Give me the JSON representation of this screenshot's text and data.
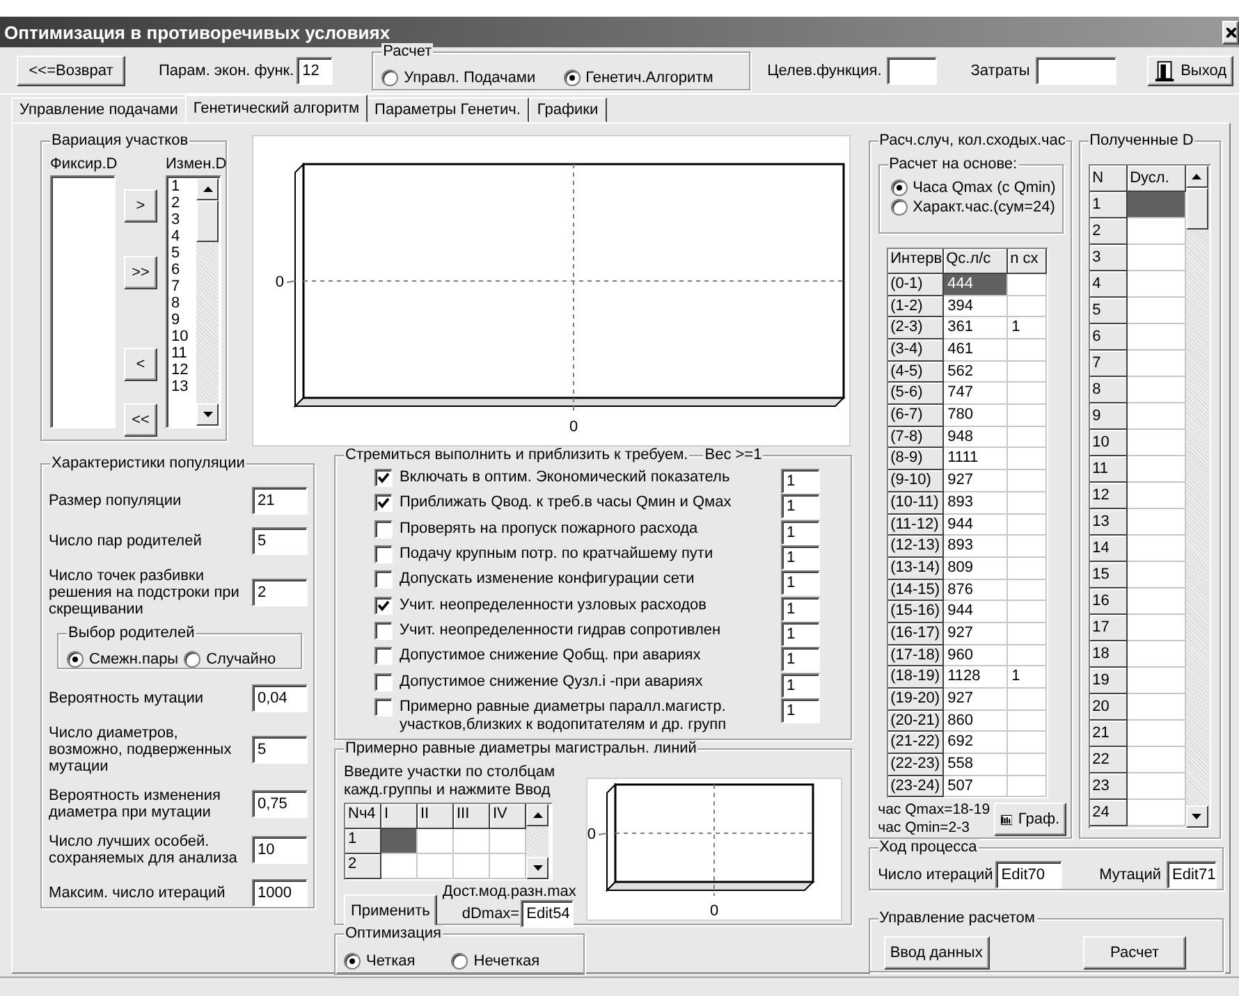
{
  "window": {
    "title": "Оптимизация в противоречивых условиях"
  },
  "toolbar": {
    "back_button": "<<=Возврат",
    "econ_param": {
      "label": "Парам. экон. функ.",
      "value": "12"
    },
    "calc_group": {
      "title": "Расчет",
      "options": [
        {
          "label": "Управл. Подачами",
          "selected": false
        },
        {
          "label": "Генетич.Алгоритм",
          "selected": true
        }
      ]
    },
    "objective": {
      "label": "Целев.функция."
    },
    "costs": {
      "label": "Затраты"
    },
    "exit_button": "Выход"
  },
  "tabs": [
    {
      "label": "Управление подачами",
      "selected": false
    },
    {
      "label": "Генетический алгоритм",
      "selected": true
    },
    {
      "label": "Параметры Генетич.",
      "selected": false
    },
    {
      "label": "Графики",
      "selected": false
    }
  ],
  "variation": {
    "title": "Вариация участков",
    "fixed_label": "Фиксир.D",
    "changed_label": "Измен.D",
    "changed_items": [
      "1",
      "2",
      "3",
      "4",
      "5",
      "6",
      "7",
      "8",
      "9",
      "10",
      "11",
      "12",
      "13"
    ],
    "buttons": [
      ">",
      ">>",
      "<",
      "<<"
    ]
  },
  "chart_top": {
    "y_tick": "0",
    "x_tick": "0"
  },
  "population": {
    "title": "Характеристики популяции",
    "items": [
      {
        "kind": "field",
        "label": "Размер популяции",
        "value": "21"
      },
      {
        "kind": "field",
        "label": "Число пар родителей",
        "value": "5"
      },
      {
        "kind": "field",
        "label": "Число точек разбивки решения на подстроки при скрещивании",
        "value": "2"
      },
      {
        "kind": "radio_group",
        "title": "Выбор родителей",
        "options": [
          {
            "label": "Смежн.пары",
            "selected": true
          },
          {
            "label": "Случайно",
            "selected": false
          }
        ]
      },
      {
        "kind": "field",
        "label": "Вероятность мутации",
        "value": "0,04"
      },
      {
        "kind": "field",
        "label": "Число диаметров, возможно, подверженных мутации",
        "value": "5"
      },
      {
        "kind": "field",
        "label": "Вероятность изменения диаметра при мутации",
        "value": "0,75"
      },
      {
        "kind": "field",
        "label": "Число лучших особей. сохраняемых для анализа",
        "value": "10"
      },
      {
        "kind": "field",
        "label": "Максим. число итераций",
        "value": "1000"
      }
    ]
  },
  "goals": {
    "title": "Стремиться выполнить и приблизить к требуем.",
    "weight_title": "Вес >=1",
    "items": [
      {
        "label": "Включать в оптим. Экономический показатель",
        "checked": true,
        "weight": "1"
      },
      {
        "label": "Приближать Qвод. к треб.в часы Qмин и Qмах",
        "checked": true,
        "weight": "1"
      },
      {
        "label": "Проверять на пропуск пожарного расхода",
        "checked": false,
        "weight": "1"
      },
      {
        "label": "Подачу крупным потр. по кратчайшему пути",
        "checked": false,
        "weight": "1"
      },
      {
        "label": "Допускать изменение конфигурации сети",
        "checked": false,
        "weight": "1"
      },
      {
        "label": "Учит. неопределенности узловых расходов",
        "checked": true,
        "weight": "1"
      },
      {
        "label": "Учит. неопределенности гидрав сопротивлен",
        "checked": false,
        "weight": "1"
      },
      {
        "label": "Допустимое снижение Qобщ. при авариях",
        "checked": false,
        "weight": "1"
      },
      {
        "label": "Допустимое снижение Qузл.i -при авариях",
        "checked": false,
        "weight": "1"
      },
      {
        "label": "Примерно равные диаметры паралл.магистр. участков,близких к водопитателям и др. групп",
        "checked": false,
        "weight": "1"
      }
    ]
  },
  "diameters": {
    "title": "Примерно равные диаметры магистральн. линий",
    "instruction": "Введите участки по столбцам кажд.группы и нажмите Ввод",
    "columns": [
      "Nч4",
      "I",
      "II",
      "III",
      "IV"
    ],
    "rows": [
      {
        "label": "1",
        "selected": true
      },
      {
        "label": "2",
        "selected": false
      }
    ],
    "apply_button": "Применить",
    "dmax_label": "Дост.мод.разн.max",
    "dmax_prefix": "dDmax=",
    "dmax_value": "Edit54",
    "chart": {
      "y_tick": "0",
      "x_tick": "0"
    }
  },
  "optimization": {
    "title": "Оптимизация",
    "options": [
      {
        "label": "Четкая",
        "selected": true
      },
      {
        "label": "Нечеткая",
        "selected": false
      }
    ]
  },
  "calc_hours": {
    "title": "Расч.случ, кол.сходых.час",
    "basis_title": "Расчет на основе:",
    "basis_options": [
      {
        "label": "Часа Qmax (с Qmin)",
        "selected": true
      },
      {
        "label": "Характ.час.(сум=24)",
        "selected": false
      }
    ],
    "columns": [
      "Интерв",
      "Qc.л/с",
      "n cx"
    ],
    "rows": [
      {
        "interval": "(0-1)",
        "q": "444",
        "selected": true
      },
      {
        "interval": "(1-2)",
        "q": "394",
        "selected": false
      },
      {
        "interval": "(2-3)",
        "q": "361",
        "n": "1",
        "selected": false
      },
      {
        "interval": "(3-4)",
        "q": "461",
        "selected": false
      },
      {
        "interval": "(4-5)",
        "q": "562",
        "selected": false
      },
      {
        "interval": "(5-6)",
        "q": "747",
        "selected": false
      },
      {
        "interval": "(6-7)",
        "q": "780",
        "selected": false
      },
      {
        "interval": "(7-8)",
        "q": "948",
        "selected": false
      },
      {
        "interval": "(8-9)",
        "q": "1111",
        "selected": false
      },
      {
        "interval": "(9-10)",
        "q": "927",
        "selected": false
      },
      {
        "interval": "(10-11)",
        "q": "893",
        "selected": false
      },
      {
        "interval": "(11-12)",
        "q": "944",
        "selected": false
      },
      {
        "interval": "(12-13)",
        "q": "893",
        "selected": false
      },
      {
        "interval": "(13-14)",
        "q": "809",
        "selected": false
      },
      {
        "interval": "(14-15)",
        "q": "876",
        "selected": false
      },
      {
        "interval": "(15-16)",
        "q": "944",
        "selected": false
      },
      {
        "interval": "(16-17)",
        "q": "927",
        "selected": false
      },
      {
        "interval": "(17-18)",
        "q": "960",
        "selected": false
      },
      {
        "interval": "(18-19)",
        "q": "1128",
        "n": "1",
        "selected": false
      },
      {
        "interval": "(19-20)",
        "q": "927",
        "selected": false
      },
      {
        "interval": "(20-21)",
        "q": "860",
        "selected": false
      },
      {
        "interval": "(21-22)",
        "q": "692",
        "selected": false
      },
      {
        "interval": "(22-23)",
        "q": "558",
        "selected": false
      },
      {
        "interval": "(23-24)",
        "q": "507",
        "selected": false
      }
    ],
    "summary": [
      "час Qmax=18-19",
      "час Qmin=2-3"
    ],
    "graph_button": "Граф."
  },
  "results": {
    "title": "Полученные D",
    "columns": [
      "N",
      "Dусл."
    ],
    "rows": [
      {
        "n": "1",
        "selected": true
      },
      {
        "n": "2",
        "selected": false
      },
      {
        "n": "3",
        "selected": false
      },
      {
        "n": "4",
        "selected": false
      },
      {
        "n": "5",
        "selected": false
      },
      {
        "n": "6",
        "selected": false
      },
      {
        "n": "7",
        "selected": false
      },
      {
        "n": "8",
        "selected": false
      },
      {
        "n": "9",
        "selected": false
      },
      {
        "n": "10",
        "selected": false
      },
      {
        "n": "11",
        "selected": false
      },
      {
        "n": "12",
        "selected": false
      },
      {
        "n": "13",
        "selected": false
      },
      {
        "n": "14",
        "selected": false
      },
      {
        "n": "15",
        "selected": false
      },
      {
        "n": "16",
        "selected": false
      },
      {
        "n": "17",
        "selected": false
      },
      {
        "n": "18",
        "selected": false
      },
      {
        "n": "19",
        "selected": false
      },
      {
        "n": "20",
        "selected": false
      },
      {
        "n": "21",
        "selected": false
      },
      {
        "n": "22",
        "selected": false
      },
      {
        "n": "23",
        "selected": false
      },
      {
        "n": "24",
        "selected": false
      }
    ]
  },
  "progress": {
    "title": "Ход процесса",
    "iterations_label": "Число итераций",
    "iterations_value": "Edit70",
    "mutations_label": "Мутаций",
    "mutations_value": "Edit71"
  },
  "control": {
    "title": "Управление расчетом",
    "buttons": [
      "Ввод данных",
      "Расчет"
    ]
  }
}
